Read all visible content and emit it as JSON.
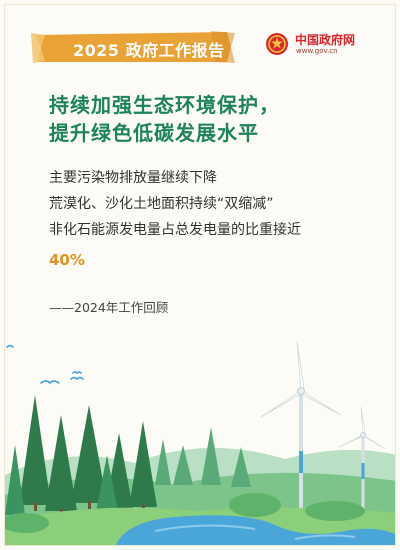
{
  "header": {
    "ribbon_title": "2025 政府工作报告",
    "logo": {
      "name": "中国政府网",
      "url": "www.gov.cn",
      "icon": "national-emblem-icon"
    }
  },
  "headline": {
    "line1": "持续加强生态环境保护，",
    "line2": "提升绿色低碳发展水平"
  },
  "body": {
    "line1": "主要污染物排放量继续下降",
    "line2": "荒漠化、沙化土地面积持续“双缩减”",
    "line3": "非化石能源发电量占总发电量的比重接近",
    "highlight": "40%"
  },
  "source": "——2024年工作回顾",
  "colors": {
    "headline_green": "#1d8458",
    "ribbon_orange": "#e8a236",
    "highlight_orange": "#e1921f",
    "logo_red": "#d8262a",
    "water_blue": "#4aa6d8",
    "tree_green": "#2f7a4a"
  }
}
